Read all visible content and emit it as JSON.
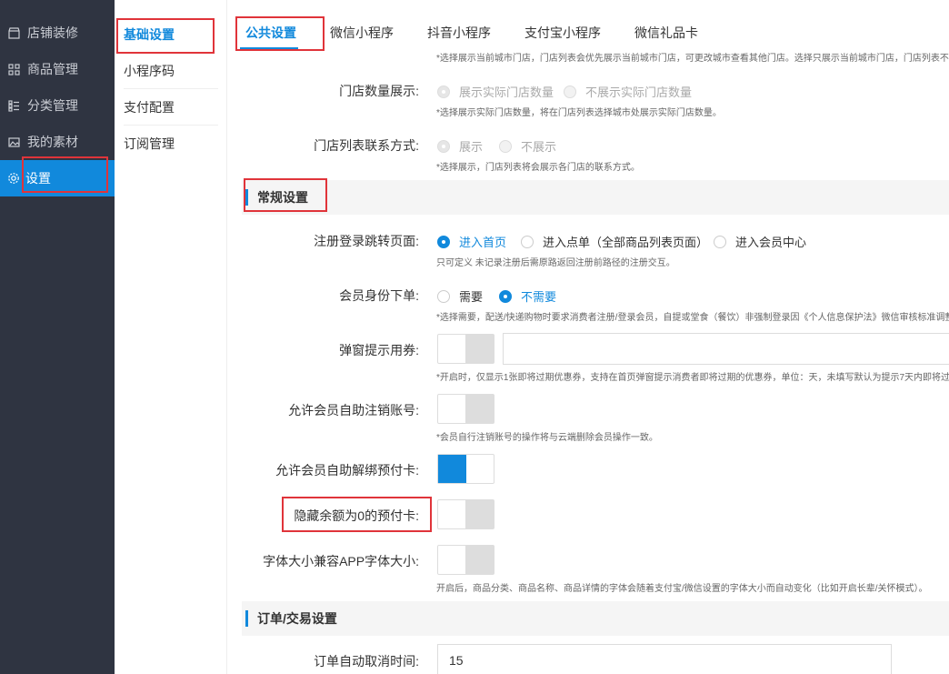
{
  "sidebar": {
    "items": [
      {
        "label": "店铺装修",
        "icon": "store-icon"
      },
      {
        "label": "商品管理",
        "icon": "grid-icon"
      },
      {
        "label": "分类管理",
        "icon": "list-icon"
      },
      {
        "label": "我的素材",
        "icon": "image-icon"
      },
      {
        "label": "设置",
        "icon": "gear-icon",
        "active": true
      }
    ]
  },
  "submenu": {
    "items": [
      {
        "label": "基础设置",
        "active": true
      },
      {
        "label": "小程序码"
      },
      {
        "label": "支付配置"
      },
      {
        "label": "订阅管理"
      }
    ]
  },
  "tabs": [
    "公共设置",
    "微信小程序",
    "抖音小程序",
    "支付宝小程序",
    "微信礼品卡"
  ],
  "store": {
    "top_hint": "*选择展示当前城市门店，门店列表会优先展示当前城市门店，可更改城市查看其他门店。选择只展示当前城市门店，门店列表不",
    "count_label": "门店数量展示:",
    "count_options": [
      "展示实际门店数量",
      "不展示实际门店数量"
    ],
    "count_hint": "*选择展示实际门店数量，将在门店列表选择城市处展示实际门店数量。",
    "contact_label": "门店列表联系方式:",
    "contact_options": [
      "展示",
      "不展示"
    ],
    "contact_hint": "*选择展示，门店列表将会展示各门店的联系方式。"
  },
  "general": {
    "title": "常规设置",
    "register_label": "注册登录跳转页面:",
    "register_options": [
      "进入首页",
      "进入点单（全部商品列表页面）",
      "进入会员中心"
    ],
    "register_hint": "只可定义 未记录注册后需原路返回注册前路径的注册交互。",
    "member_label": "会员身份下单:",
    "member_options": [
      "需要",
      "不需要"
    ],
    "member_hint": "*选择需要，配送/快递购物时要求消费者注册/登录会员，自提或堂食（餐饮）非强制登录因《个人信息保护法》微信审核标准调整",
    "popup_label": "弹窗提示用券:",
    "popup_hint": "*开启时，仅显示1张即将过期优惠券，支持在首页弹窗提示消费者即将过期的优惠券，单位：天，未填写默认为提示7天内即将过",
    "cancel_label": "允许会员自助注销账号:",
    "cancel_hint": "*会员自行注销账号的操作将与云端删除会员操作一致。",
    "unbind_label": "允许会员自助解绑预付卡:",
    "hide_label": "隐藏余额为0的预付卡:",
    "font_label": "字体大小兼容APP字体大小:",
    "font_hint": "开启后，商品分类、商品名称、商品详情的字体会随着支付宝/微信设置的字体大小而自动变化（比如开启长辈/关怀模式）。"
  },
  "order": {
    "title": "订单/交易设置",
    "auto_cancel_label": "订单自动取消时间:",
    "auto_cancel_value": "15"
  },
  "colors": {
    "accent": "#1189dc",
    "sidebar_bg": "#2f3441",
    "highlight": "#e0343a"
  }
}
